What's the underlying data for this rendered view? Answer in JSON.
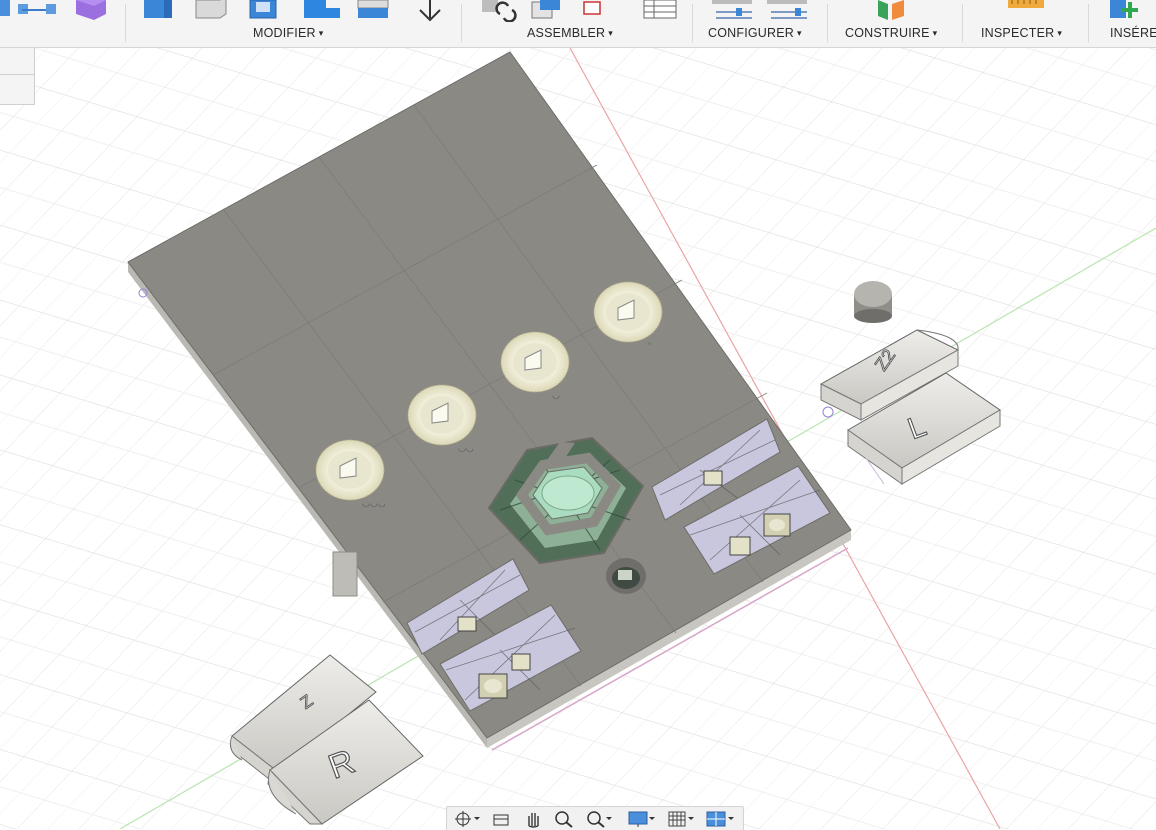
{
  "toolbar": {
    "groups": [
      {
        "label": "MODIFIER"
      },
      {
        "label": "ASSEMBLER"
      },
      {
        "label": "CONFIGURER"
      },
      {
        "label": "CONSTRUIRE"
      },
      {
        "label": "INSPECTER"
      },
      {
        "label": "INSÉRE"
      }
    ],
    "caret": "▾"
  },
  "model": {
    "buttons": {
      "left_top": "Z",
      "left_bottom": "R",
      "right_top": "Z2",
      "right_bottom": "L"
    }
  },
  "colors": {
    "plate_top": "#8a8984",
    "plate_side": "#b9b8b2",
    "grid": "#dcdcdc",
    "axis_red": "#e8a5a5",
    "axis_green": "#b8e8b0",
    "ring": "#efedd6",
    "accent": "#2b7fd4"
  },
  "navbar": {
    "items": [
      "orbit-icon",
      "look-at-icon",
      "pan-icon",
      "zoom-icon",
      "zoom-window-icon",
      "display-settings-icon",
      "grid-settings-icon",
      "viewports-icon"
    ]
  }
}
